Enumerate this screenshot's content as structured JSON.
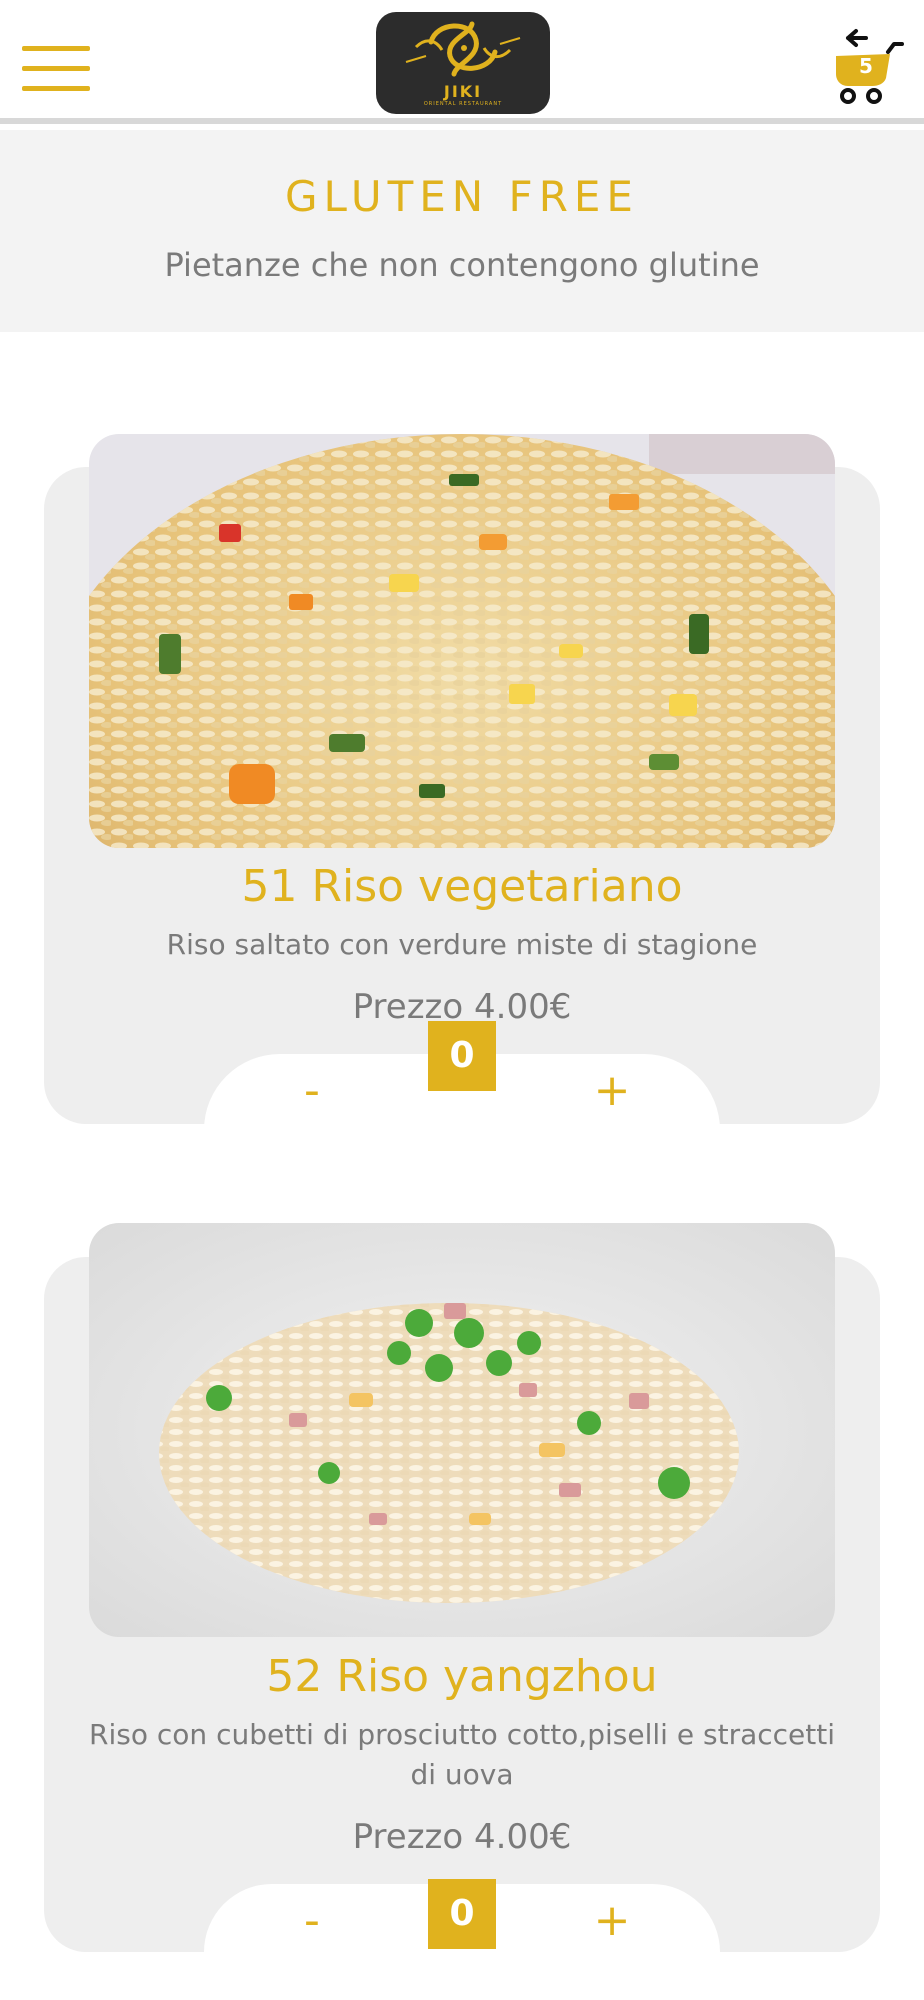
{
  "header": {
    "menu_icon": "hamburger-icon",
    "logo_text": "JIKI",
    "logo_subtext": "ORIENTAL RESTAURANT",
    "cart_icon": "shopping-cart-back-icon",
    "cart_count": "5"
  },
  "category": {
    "title": "GLUTEN FREE",
    "subtitle": "Pietanze che non contengono glutine"
  },
  "products": [
    {
      "title": "51 Riso vegetariano",
      "description": "Riso saltato con verdure miste di stagione",
      "price": "Prezzo 4.00€",
      "minus_label": "-",
      "quantity": "0",
      "plus_label": "+"
    },
    {
      "title": "52 Riso yangzhou",
      "description": "Riso con cubetti di prosciutto cotto,piselli e straccetti di uova",
      "price": "Prezzo 4.00€",
      "minus_label": "-",
      "quantity": "0",
      "plus_label": "+"
    }
  ],
  "colors": {
    "accent": "#e0b21e",
    "text_gray": "#7a7a7a",
    "card_bg": "#eeeeee",
    "banner_bg": "#f3f3f3"
  }
}
